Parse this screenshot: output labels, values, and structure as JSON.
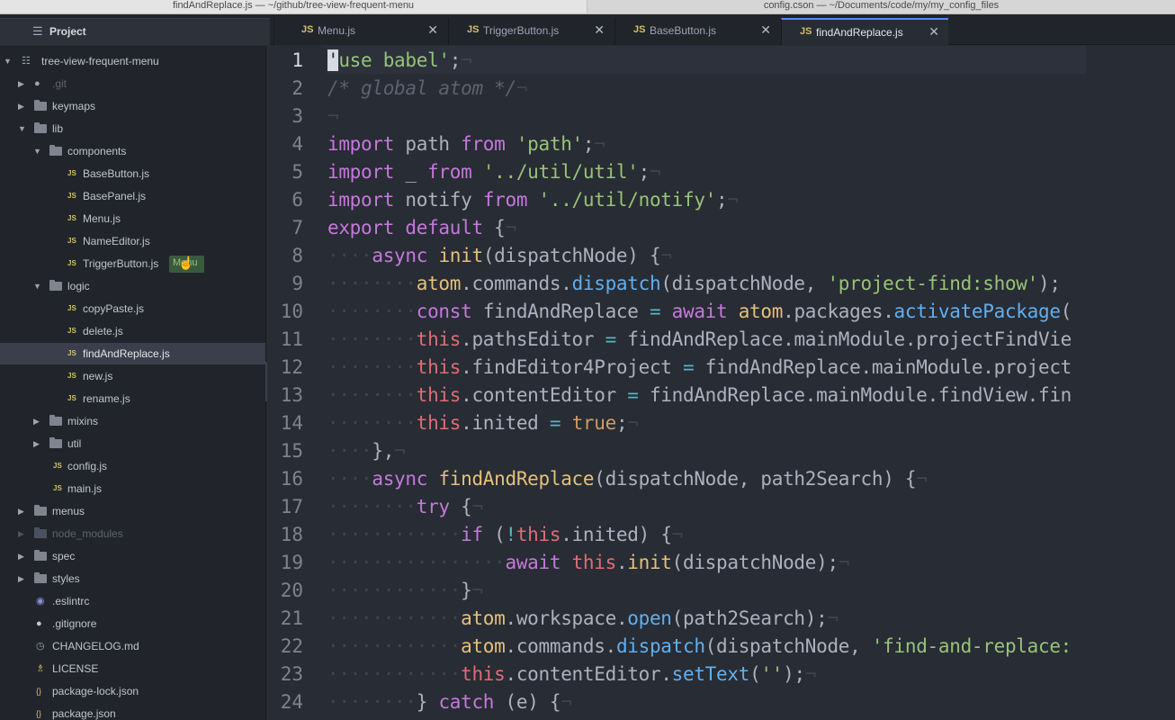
{
  "os_windows": [
    "findAndReplace.js — ~/github/tree-view-frequent-menu",
    "config.cson — ~/Documents/code/my/my_config_files"
  ],
  "tabs": {
    "project_label": "Project",
    "files": [
      {
        "label": "Menu.js",
        "badge": "JS"
      },
      {
        "label": "TriggerButton.js",
        "badge": "JS"
      },
      {
        "label": "BaseButton.js",
        "badge": "JS"
      },
      {
        "label": "findAndReplace.js",
        "badge": "JS"
      }
    ],
    "active": "findAndReplace.js"
  },
  "tree": {
    "root": "tree-view-frequent-menu",
    "items": [
      {
        "name": ".git",
        "kind": "repo"
      },
      {
        "name": "keymaps",
        "kind": "folder"
      },
      {
        "name": "lib",
        "kind": "folder"
      },
      {
        "name": "components",
        "kind": "folder"
      },
      {
        "name": "BaseButton.js",
        "kind": "js"
      },
      {
        "name": "BasePanel.js",
        "kind": "js"
      },
      {
        "name": "Menu.js",
        "kind": "js"
      },
      {
        "name": "NameEditor.js",
        "kind": "js"
      },
      {
        "name": "TriggerButton.js",
        "kind": "js"
      },
      {
        "name": "logic",
        "kind": "folder"
      },
      {
        "name": "copyPaste.js",
        "kind": "js"
      },
      {
        "name": "delete.js",
        "kind": "js"
      },
      {
        "name": "findAndReplace.js",
        "kind": "js"
      },
      {
        "name": "new.js",
        "kind": "js"
      },
      {
        "name": "rename.js",
        "kind": "js"
      },
      {
        "name": "mixins",
        "kind": "folder"
      },
      {
        "name": "util",
        "kind": "folder"
      },
      {
        "name": "config.js",
        "kind": "js"
      },
      {
        "name": "main.js",
        "kind": "js"
      },
      {
        "name": "menus",
        "kind": "folder"
      },
      {
        "name": "node_modules",
        "kind": "folder"
      },
      {
        "name": "spec",
        "kind": "folder"
      },
      {
        "name": "styles",
        "kind": "folder"
      },
      {
        "name": ".eslintrc",
        "kind": "file"
      },
      {
        "name": ".gitignore",
        "kind": "file"
      },
      {
        "name": "CHANGELOG.md",
        "kind": "file"
      },
      {
        "name": "LICENSE",
        "kind": "file"
      },
      {
        "name": "package-lock.json",
        "kind": "json"
      },
      {
        "name": "package.json",
        "kind": "json"
      }
    ],
    "hover_badge": "Menu"
  },
  "editor": {
    "line_numbers": [
      "1",
      "2",
      "3",
      "4",
      "5",
      "6",
      "7",
      "8",
      "9",
      "10",
      "11",
      "12",
      "13",
      "14",
      "15",
      "16",
      "17",
      "18",
      "19",
      "20",
      "21",
      "22",
      "23",
      "24"
    ],
    "lines": [
      "'use babel';",
      "/* global atom */",
      "",
      "import path from 'path';",
      "import _ from '../util/util';",
      "import notify from '../util/notify';",
      "export default {",
      "  async init(dispatchNode) {",
      "    atom.commands.dispatch(dispatchNode, 'project-find:show');",
      "    const findAndReplace = await atom.packages.activatePackage(",
      "    this.pathsEditor = findAndReplace.mainModule.projectFindVie",
      "    this.findEditor4Project = findAndReplace.mainModule.project",
      "    this.contentEditor = findAndReplace.mainModule.findView.fin",
      "    this.inited = true;",
      "  },",
      "  async findAndReplace(dispatchNode, path2Search) {",
      "    try {",
      "      if (!this.inited) {",
      "        await this.init(dispatchNode);",
      "      }",
      "      atom.workspace.open(path2Search);",
      "      atom.commands.dispatch(dispatchNode, 'find-and-replace:",
      "      this.contentEditor.setText('');",
      "    } catch (e) {"
    ]
  },
  "colors": {
    "accent": "#568af2",
    "keyword": "#c678dd",
    "string": "#98c379",
    "function": "#61afef",
    "background": "#282c34"
  }
}
